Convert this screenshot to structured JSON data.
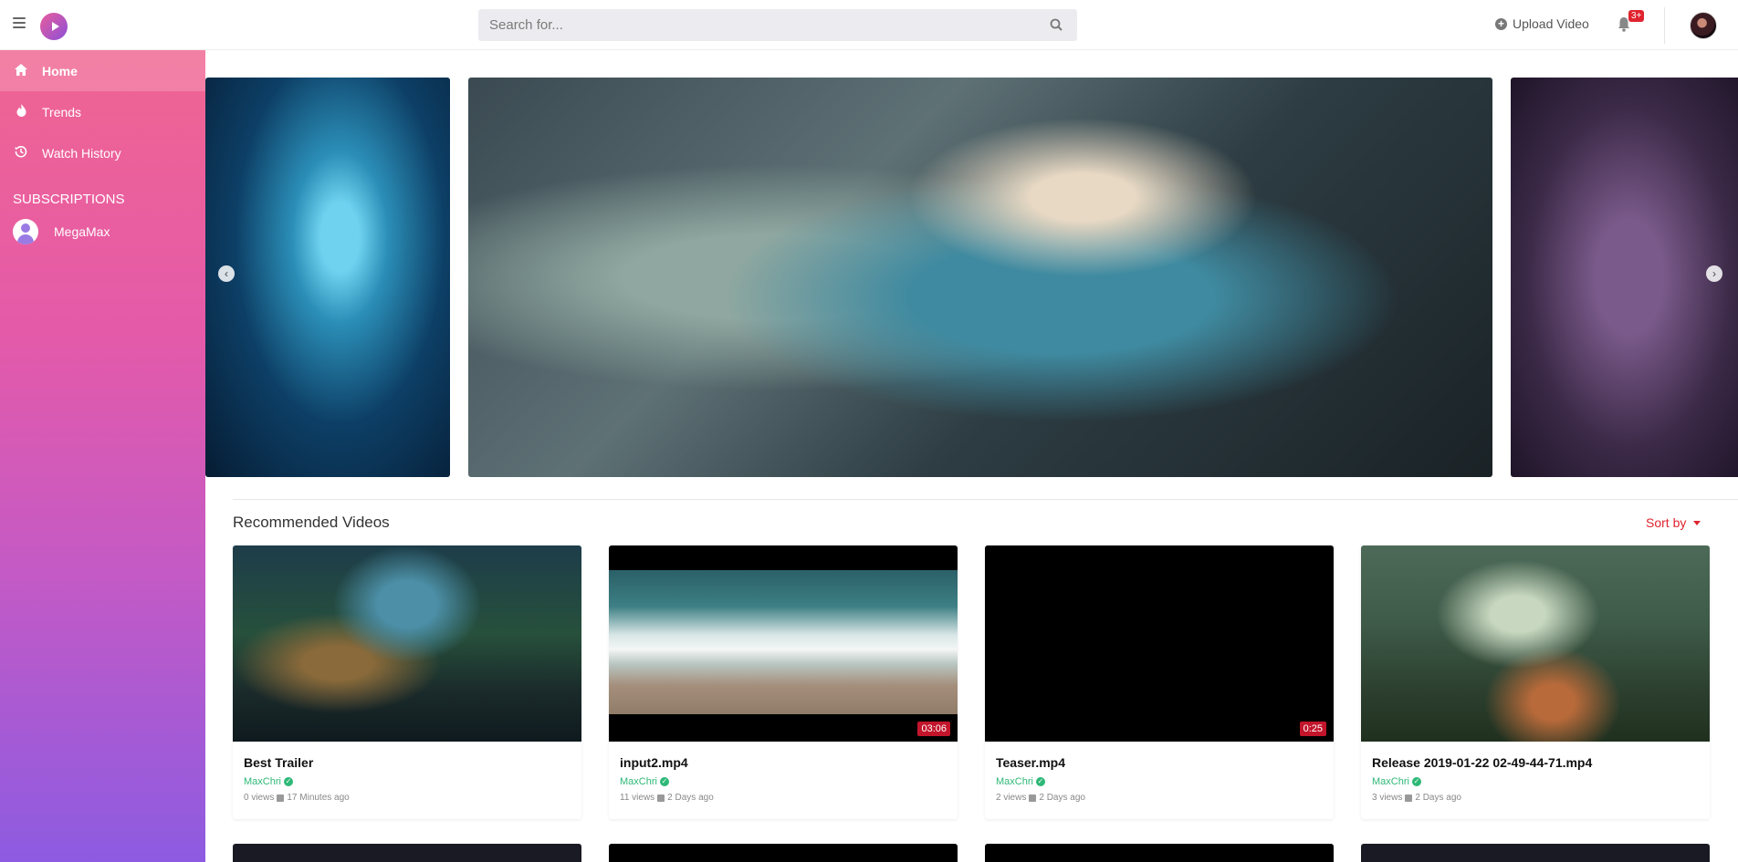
{
  "header": {
    "search_placeholder": "Search for...",
    "upload_label": "Upload Video",
    "notification_badge": "3+"
  },
  "sidebar": {
    "items": [
      {
        "label": "Home",
        "icon": "home-icon",
        "active": true
      },
      {
        "label": "Trends",
        "icon": "fire-icon",
        "active": false
      },
      {
        "label": "Watch History",
        "icon": "history-icon",
        "active": false
      }
    ],
    "subscriptions_title": "SUBSCRIPTIONS",
    "subscriptions": [
      {
        "name": "MegaMax"
      }
    ]
  },
  "main": {
    "section_title": "Recommended Videos",
    "sort_label": "Sort by",
    "videos": [
      {
        "title": "Best Trailer",
        "channel": "MaxChri",
        "views": "0 views",
        "age": "17 Minutes ago",
        "duration": ""
      },
      {
        "title": "input2.mp4",
        "channel": "MaxChri",
        "views": "11 views",
        "age": "2 Days ago",
        "duration": "03:06"
      },
      {
        "title": "Teaser.mp4",
        "channel": "MaxChri",
        "views": "2 views",
        "age": "2 Days ago",
        "duration": "0:25"
      },
      {
        "title": "Release 2019-01-22 02-49-44-71.mp4",
        "channel": "MaxChri",
        "views": "3 views",
        "age": "2 Days ago",
        "duration": ""
      }
    ]
  },
  "colors": {
    "accent": "#e0242f",
    "verified": "#2eb877",
    "sidebar_top": "#f06591",
    "sidebar_bottom": "#8d5be1"
  }
}
